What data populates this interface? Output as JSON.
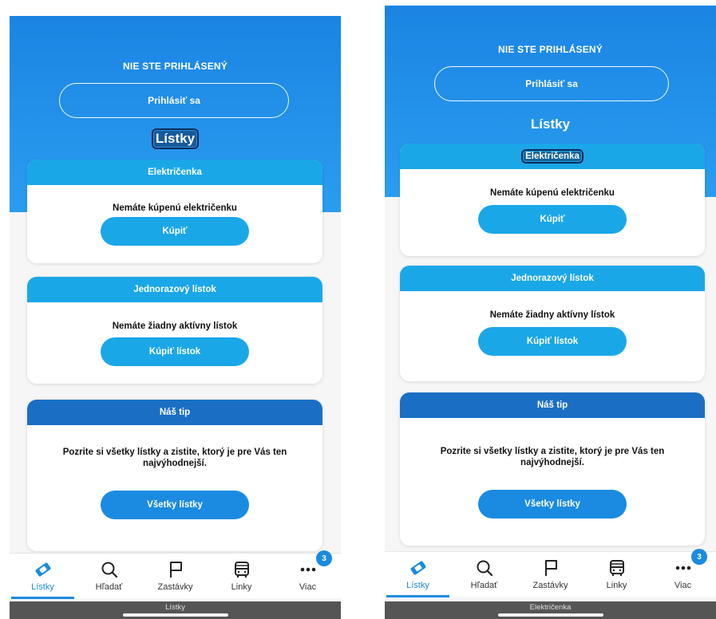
{
  "screens": [
    {
      "status": "NIE STE PRIHLÁSENÝ",
      "login_label": "Prihlásiť sa",
      "heading": "Lístky",
      "cards": {
        "tram": {
          "title": "Električenka",
          "message": "Nemáte kúpenú električenku",
          "button": "Kúpiť"
        },
        "single": {
          "title": "Jednorazový lístok",
          "message": "Nemáte žiadny aktívny lístok",
          "button": "Kúpiť lístok"
        },
        "tip": {
          "title": "Náš tip",
          "message": "Pozrite si všetky lístky a zistite, ktorý je pre Vás ten najvýhodnejší.",
          "button": "Všetky lístky"
        }
      },
      "tabs": [
        {
          "label": "Lístky",
          "icon": "ticket-icon"
        },
        {
          "label": "Hľadať",
          "icon": "search-icon"
        },
        {
          "label": "Zastávky",
          "icon": "flag-icon"
        },
        {
          "label": "Linky",
          "icon": "bus-icon"
        },
        {
          "label": "Viac",
          "icon": "more-icon",
          "badge": "3"
        }
      ],
      "accessibility_caption": "Lístky"
    },
    {
      "status": "NIE STE PRIHLÁSENÝ",
      "login_label": "Prihlásiť sa",
      "heading": "Lístky",
      "cards": {
        "tram": {
          "title": "Električenka",
          "message": "Nemáte kúpenú električenku",
          "button": "Kúpiť"
        },
        "single": {
          "title": "Jednorazový lístok",
          "message": "Nemáte žiadny aktívny lístok",
          "button": "Kúpiť lístok"
        },
        "tip": {
          "title": "Náš tip",
          "message": "Pozrite si všetky lístky a zistite, ktorý je pre Vás ten najvýhodnejší.",
          "button": "Všetky lístky"
        }
      },
      "tabs": [
        {
          "label": "Lístky",
          "icon": "ticket-icon"
        },
        {
          "label": "Hľadať",
          "icon": "search-icon"
        },
        {
          "label": "Zastávky",
          "icon": "flag-icon"
        },
        {
          "label": "Linky",
          "icon": "bus-icon"
        },
        {
          "label": "Viac",
          "icon": "more-icon",
          "badge": "3"
        }
      ],
      "accessibility_caption": "Električenka"
    }
  ],
  "colors": {
    "hero_blue": "#1b84e3",
    "cyan_header": "#1aa7e8",
    "dark_header": "#1a6fc4",
    "accent": "#1a8be0"
  }
}
